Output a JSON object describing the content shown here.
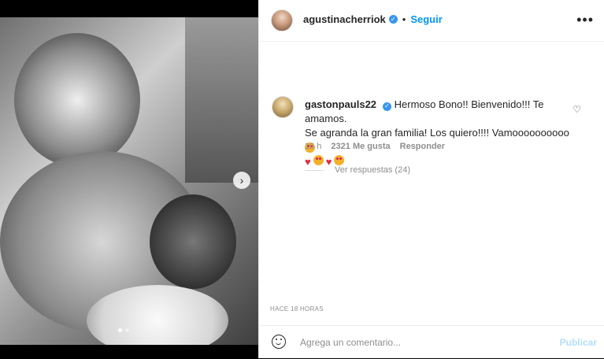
{
  "post": {
    "author": "agustinacherriok",
    "follow_label": "Seguir",
    "separator": "•"
  },
  "comment": {
    "username": "gastonpauls22",
    "text_line_1": "Hermoso Bono!! Bienvenido!!! Te amamos.",
    "text_line_2": "Se agranda la gran familia! Los quiero!!!! Vamoooooooooo",
    "age": "18 h",
    "likes": "2321 Me gusta",
    "reply_label": "Responder",
    "view_replies": "Ver respuestas (24)"
  },
  "timestamp": "HACE 18 HORAS",
  "composer": {
    "placeholder": "Agrega un comentario...",
    "publish_label": "Publicar"
  },
  "icons": {
    "verified": "verified-badge-icon",
    "more": "more-options-icon",
    "like": "heart-like-icon",
    "emoji": "emoji-picker-icon",
    "next": "chevron-right-icon"
  },
  "colors": {
    "link_blue": "#0095f6",
    "verified_blue": "#3897f0",
    "muted_gray": "#8e8e8e",
    "publish_disabled": "#b2dffc"
  }
}
